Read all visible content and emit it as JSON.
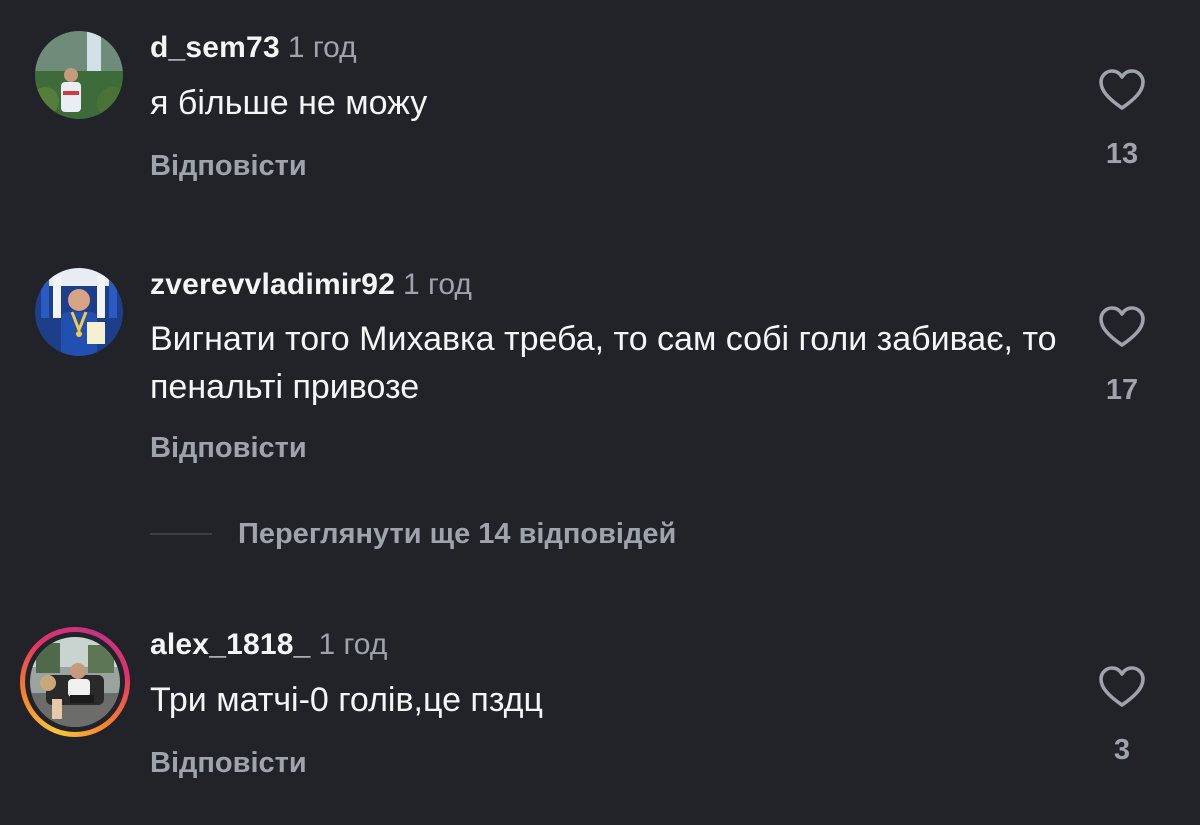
{
  "comments": [
    {
      "username": "d_sem73",
      "time": "1 год",
      "text": "я більше не можу",
      "reply_label": "Відповісти",
      "likes": "13",
      "avatar_icon": "avatar-photo-waterfall",
      "has_story_ring": false
    },
    {
      "username": "zverevvladimir92",
      "time": "1 год",
      "text": "Вигнати того Михавка треба, то сам собі голи забиває, то пенальті привозе",
      "reply_label": "Відповісти",
      "likes": "17",
      "avatar_icon": "avatar-photo-award",
      "has_story_ring": false
    },
    {
      "username": "alex_1818_",
      "time": "1 год",
      "text": "Три матчі-0 голів,це пздц",
      "reply_label": "Відповісти",
      "likes": "3",
      "avatar_icon": "avatar-photo-seated",
      "has_story_ring": true
    }
  ],
  "view_more_replies": "Переглянути ще 14 відповідей",
  "icons": {
    "like": "heart-outline-icon"
  },
  "colors": {
    "background": "#212328",
    "text_primary": "#f5f5f5",
    "text_secondary": "#9ea3ac"
  }
}
